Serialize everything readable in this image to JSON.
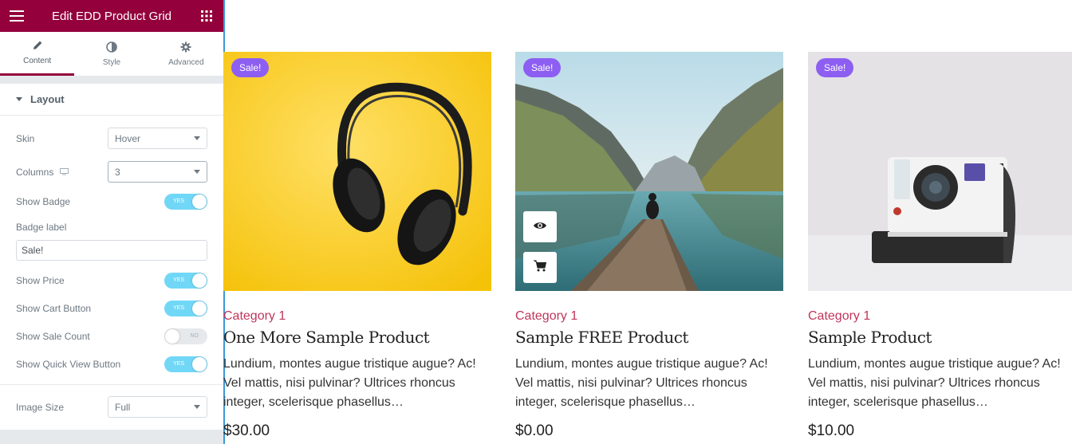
{
  "panel": {
    "title": "Edit EDD Product Grid",
    "tabs": [
      {
        "label": "Content",
        "icon": "pencil-icon"
      },
      {
        "label": "Style",
        "icon": "contrast-icon"
      },
      {
        "label": "Advanced",
        "icon": "gear-icon"
      }
    ],
    "section": "Layout",
    "controls": {
      "skin": {
        "label": "Skin",
        "value": "Hover"
      },
      "columns": {
        "label": "Columns",
        "value": "3"
      },
      "show_badge": {
        "label": "Show Badge",
        "state": "YES"
      },
      "badge_label": {
        "label": "Badge label",
        "value": "Sale!"
      },
      "show_price": {
        "label": "Show Price",
        "state": "YES"
      },
      "show_cart": {
        "label": "Show Cart Button",
        "state": "YES"
      },
      "show_sale_count": {
        "label": "Show Sale Count",
        "state": "NO"
      },
      "show_quick_view": {
        "label": "Show Quick View Button",
        "state": "YES"
      },
      "image_size": {
        "label": "Image Size",
        "value": "Full"
      }
    }
  },
  "products": [
    {
      "badge": "Sale!",
      "category": "Category 1",
      "name": "One More Sample Product",
      "desc": "Lundium, montes augue tristique augue? Ac! Vel mattis, nisi pulvinar? Ultrices rhoncus integer, scelerisque phasellus…",
      "price": "$30.00"
    },
    {
      "badge": "Sale!",
      "category": "Category 1",
      "name": "Sample FREE Product",
      "desc": "Lundium, montes augue tristique augue? Ac! Vel mattis, nisi pulvinar? Ultrices rhoncus integer, scelerisque phasellus…",
      "price": "$0.00"
    },
    {
      "badge": "Sale!",
      "category": "Category 1",
      "name": "Sample Product",
      "desc": "Lundium, montes augue tristique augue? Ac! Vel mattis, nisi pulvinar? Ultrices rhoncus integer, scelerisque phasellus…",
      "price": "$10.00"
    }
  ],
  "colors": {
    "brand": "#93003c",
    "badge": "#8d5ef2",
    "category": "#c0365a",
    "toggle_on": "#71d7f7"
  }
}
